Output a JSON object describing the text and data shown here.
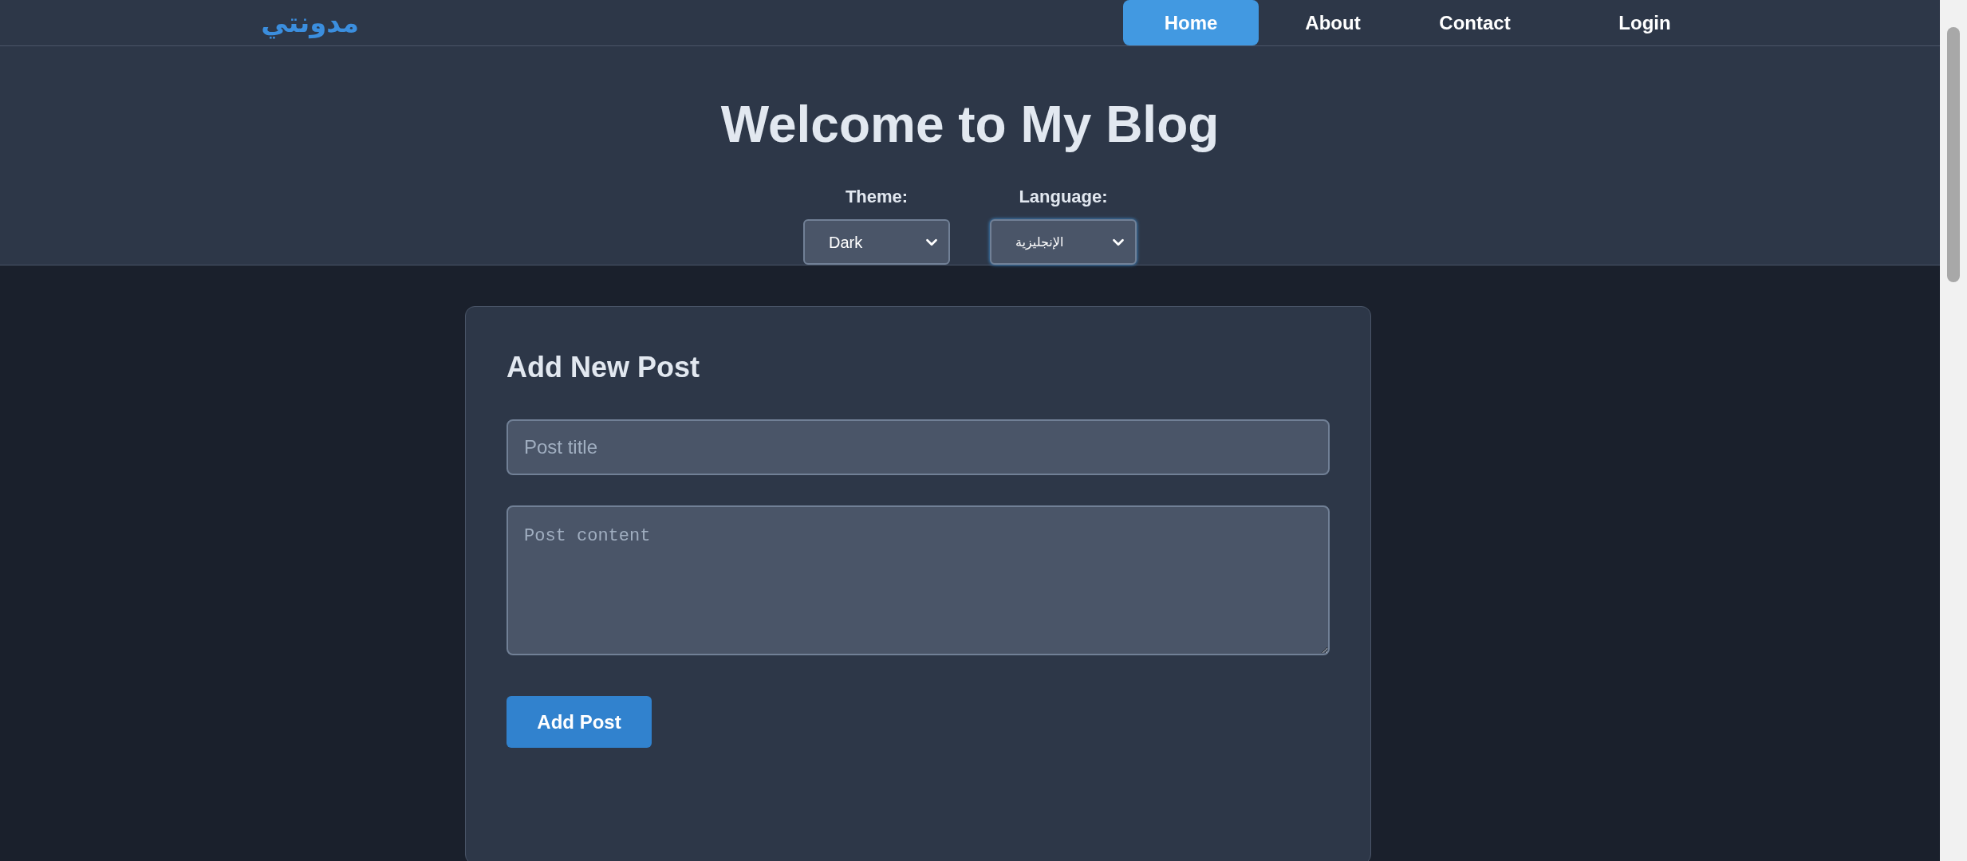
{
  "header": {
    "logo": "مدونتي",
    "nav": [
      {
        "label": "Home",
        "selected": true
      },
      {
        "label": "About",
        "selected": false
      },
      {
        "label": "Contact",
        "selected": false
      },
      {
        "label": "Login",
        "selected": false
      }
    ]
  },
  "hero": {
    "title": "Welcome to My Blog",
    "selects": [
      {
        "label": "Theme:",
        "value": "Dark"
      },
      {
        "label": "Language:",
        "value": "الإنجليزية"
      }
    ]
  },
  "form": {
    "title": "Add New Post",
    "title_field": {
      "placeholder": "Post title"
    },
    "content_field": {
      "placeholder": "Post content"
    },
    "submit": "Add Post"
  }
}
